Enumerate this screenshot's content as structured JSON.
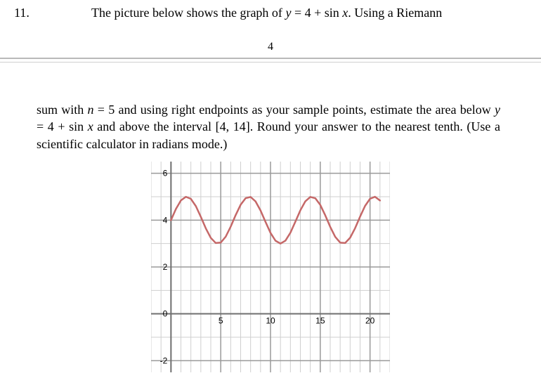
{
  "problem": {
    "number": "11.",
    "intro_text_html": "The picture below shows the graph of <span class='math-it'>y</span> = 4 + sin <span class='math-it'>x</span>. Using a Riemann",
    "page_number": "4",
    "body_text_html": "sum with <span class='math-it'>n</span> = 5 and using right endpoints as your sample points, estimate the area below <span class='math-it'>y</span> = 4 + sin <span class='math-it'>x</span> and above the interval [4, 14]. Round your answer to the nearest tenth. (Use a scientific calculator in radians mode.)"
  },
  "chart_data": {
    "type": "line",
    "title": "",
    "xlabel": "",
    "ylabel": "",
    "xlim": [
      -2,
      22
    ],
    "ylim": [
      -2.5,
      6.5
    ],
    "x_ticks": [
      0,
      5,
      10,
      15,
      20
    ],
    "y_ticks": [
      -2,
      0,
      2,
      4,
      6
    ],
    "grid_step_x": 1,
    "grid_step_y": 1,
    "series": [
      {
        "name": "y = 4 + sin(x)",
        "color": "#c56868",
        "x": [
          0,
          0.5,
          1,
          1.5,
          2,
          2.5,
          3,
          3.5,
          4,
          4.5,
          5,
          5.5,
          6,
          6.5,
          7,
          7.5,
          8,
          8.5,
          9,
          9.5,
          10,
          10.5,
          11,
          11.5,
          12,
          12.5,
          13,
          13.5,
          14,
          14.5,
          15,
          15.5,
          16,
          16.5,
          17,
          17.5,
          18,
          18.5,
          19,
          19.5,
          20,
          20.5,
          21
        ],
        "y": [
          4,
          4.479,
          4.841,
          4.997,
          4.909,
          4.599,
          4.141,
          3.649,
          3.243,
          3.022,
          3.041,
          3.294,
          3.721,
          4.215,
          4.657,
          4.938,
          4.989,
          4.798,
          4.412,
          3.925,
          3.456,
          3.121,
          3,
          3.124,
          3.463,
          3.934,
          4.42,
          4.804,
          4.991,
          4.935,
          4.65,
          4.206,
          3.712,
          3.288,
          3.039,
          3.024,
          3.249,
          3.657,
          4.15,
          4.607,
          4.913,
          4.998,
          4.837
        ]
      }
    ]
  }
}
